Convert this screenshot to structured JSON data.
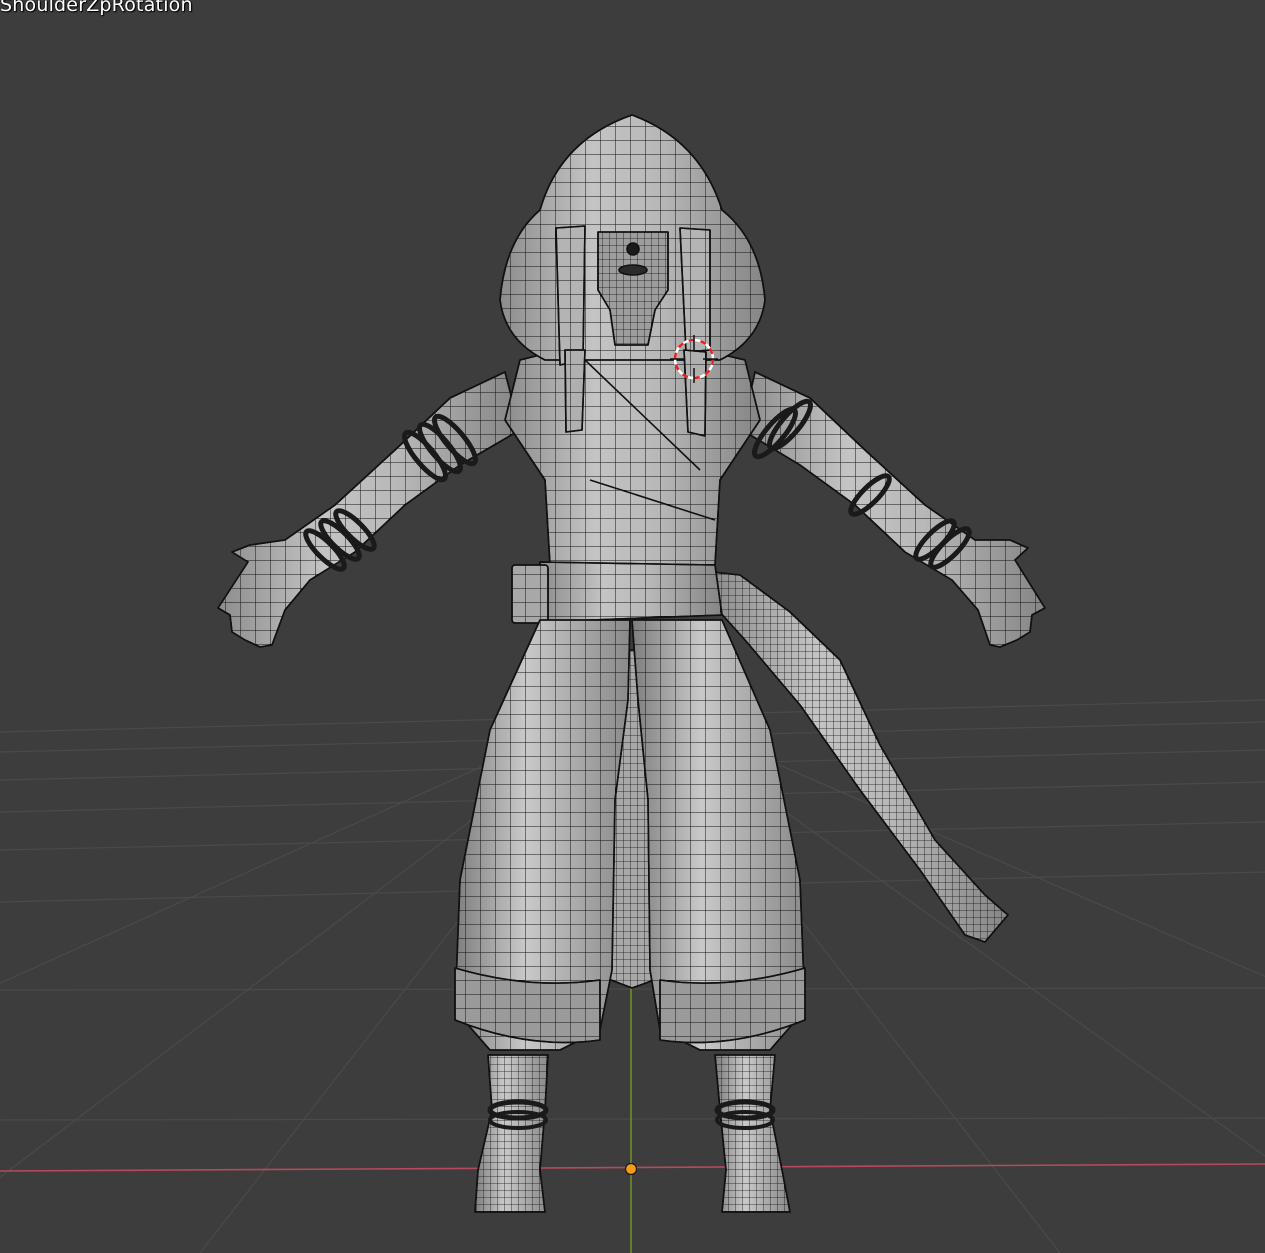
{
  "viewport": {
    "object_label": "ShoulderZpRotation",
    "view": "front",
    "shading": "solid-with-wireframe",
    "colors": {
      "background": "#3d3d3d",
      "grid_line": "#4a4a4a",
      "x_axis": "#b54a5c",
      "y_axis": "#6b8f2e",
      "mesh_fill": "#a9a9a9",
      "mesh_highlight": "#c7c7c7",
      "wire": "#111111",
      "origin_dot": "#f59a1b",
      "cursor_red": "#e02424",
      "cursor_white": "#ffffff"
    },
    "icons": {
      "3d_cursor": "3d-cursor-icon",
      "origin": "origin-point-icon"
    }
  }
}
